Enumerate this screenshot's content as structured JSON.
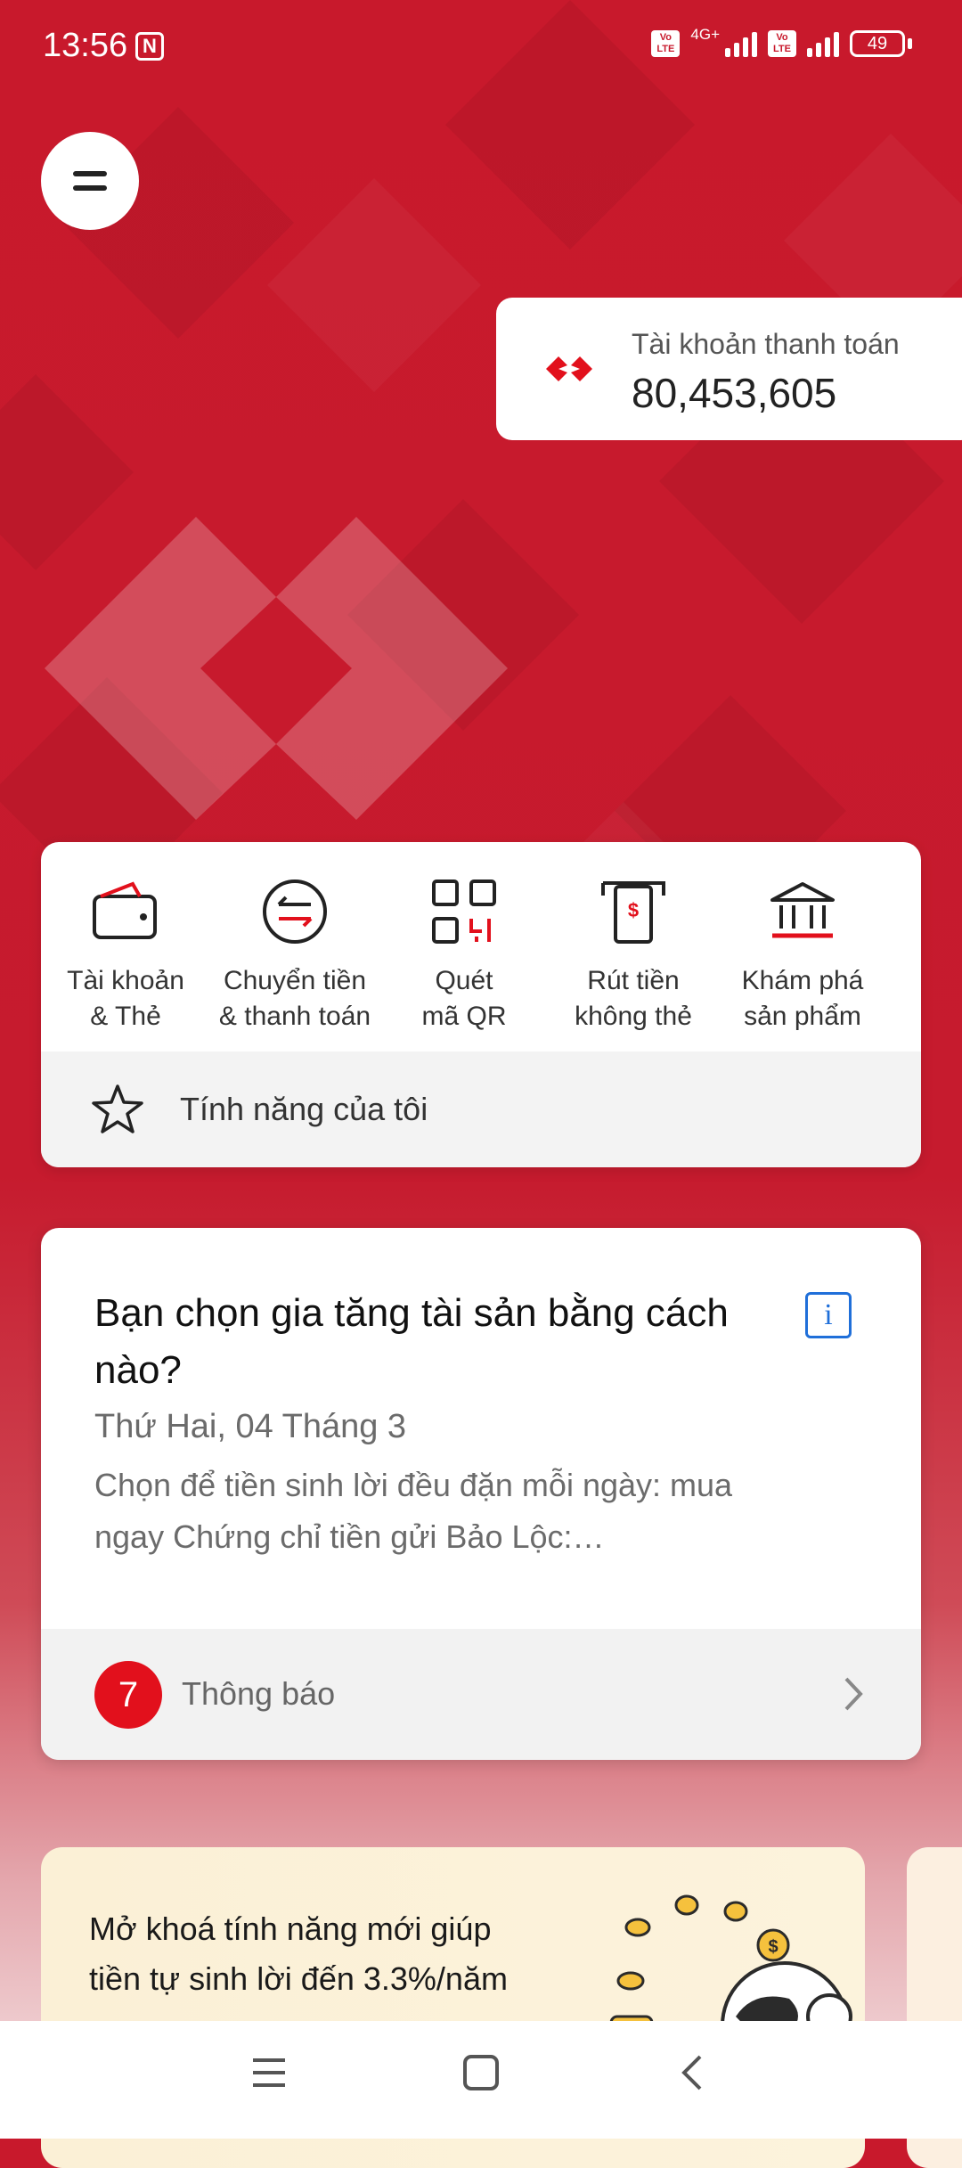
{
  "status_bar": {
    "time": "13:56",
    "network": "4G+",
    "volte_label": "Vo LTE",
    "battery": "49"
  },
  "account": {
    "label": "Tài khoản thanh toán",
    "balance": "80,453,605"
  },
  "quick_actions": [
    {
      "label_line1": "Tài khoản",
      "label_line2": "& Thẻ",
      "icon": "wallet-icon"
    },
    {
      "label_line1": "Chuyển tiền",
      "label_line2": "& thanh toán",
      "icon": "transfer-icon"
    },
    {
      "label_line1": "Quét",
      "label_line2": "mã QR",
      "icon": "qr-scan-icon"
    },
    {
      "label_line1": "Rút tiền",
      "label_line2": "không thẻ",
      "icon": "atm-withdraw-icon"
    },
    {
      "label_line1": "Khám phá",
      "label_line2": "sản phẩm",
      "icon": "bank-icon"
    }
  ],
  "my_features": {
    "label": "Tính năng của tôi",
    "icon": "star-icon"
  },
  "notification": {
    "title": "Bạn chọn gia tăng tài sản bằng cách nào?",
    "date": "Thứ Hai, 04 Tháng 3",
    "body": "Chọn để tiền sinh lời đều đặn mỗi ngày: mua ngay Chứng chỉ tiền gửi Bảo Lộc:…",
    "footer_label": "Thông báo",
    "count": "7"
  },
  "promo": {
    "line1": "Mở khoá tính năng mới giúp",
    "line2": "tiền tự sinh lời đến 3.3%/năm"
  },
  "colors": {
    "brand_red": "#c8192c",
    "badge_red": "#e2101c",
    "info_blue": "#1f6fd9"
  }
}
